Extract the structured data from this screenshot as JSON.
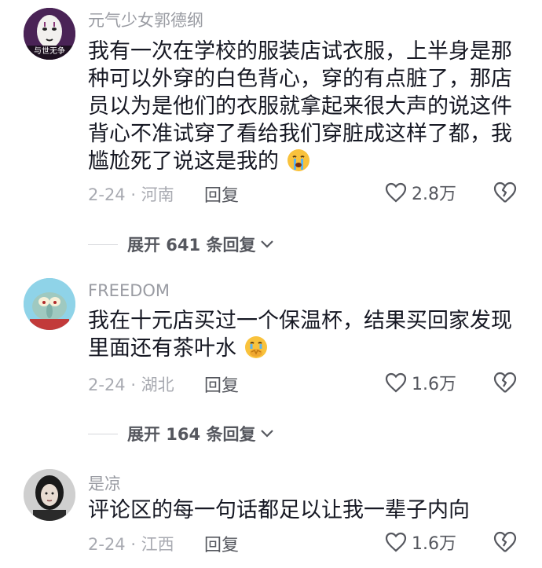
{
  "comments": [
    {
      "username": "元气少女郭德纲",
      "avatar_text": "与世无争",
      "text": "我有一次在学校的服装店试衣服，上半身是那种可以外穿的白色背心，穿的有点脏了，那店员以为是他们的衣服就拿起来很大声的说这件背心不准试穿了看给我们穿脏成这样了都，我尴尬死了说这是我的",
      "emoji": "crying-face",
      "meta": "2-24 · 河南",
      "reply_label": "回复",
      "likes": "2.8万",
      "expand_label": "展开 641 条回复"
    },
    {
      "username": "FREEDOM",
      "text": "我在十元店买过一个保温杯，结果买回家发现里面还有茶叶水",
      "emoji": "hand-over-mouth-face",
      "meta": "2-24 · 湖北",
      "reply_label": "回复",
      "likes": "1.6万",
      "expand_label": "展开 164 条回复"
    },
    {
      "username": "是凉",
      "text": "评论区的每一句话都足以让我一辈子内向",
      "meta": "2-24 · 江西",
      "reply_label": "回复",
      "likes": "1.6万"
    }
  ],
  "colors": {
    "username": "#9a9ca3",
    "text": "#161823",
    "meta": "#a8aab1",
    "action": "#55575e"
  }
}
